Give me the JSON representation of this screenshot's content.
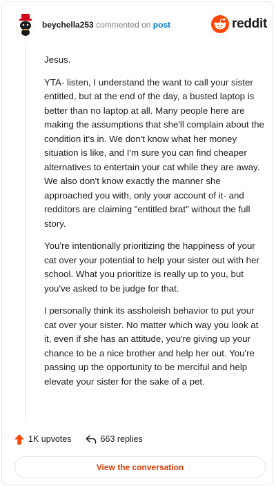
{
  "header": {
    "username": "beychella253",
    "action_text": "commented on",
    "post_link": "post",
    "brand": "reddit"
  },
  "comment": {
    "paragraphs": [
      "Jesus.",
      "YTA- listen, I understand the want to call your sister entitled, but at the end of the day, a busted laptop is better than no laptop at all. Many people here are making the assumptions that she'll complain about the condition it's in. We don't know what her money situation is like, and I'm sure you can find cheaper alternatives to entertain your cat while they are away. We also don't know exactly the manner she approached you with, only your account of it- and redditors are claiming \"entitled brat\" without the full story.",
      "You're intentionally prioritizing the happiness of your cat over your potential to help your sister out with her school. What you prioritize is really up to you, but you've asked to be judge for that.",
      "I personally think its assholeish behavior to put your cat over your sister. No matter which way you look at it, even if she has an attitude, you're giving up your chance to be a nice brother and help her out. You're passing up the opportunity to be merciful and help elevate your sister for the sake of a pet."
    ]
  },
  "actions": {
    "upvotes": "1K upvotes",
    "replies": "663 replies"
  },
  "cta_label": "View the conversation",
  "colors": {
    "accent_orange": "#d93a00",
    "upvote_red": "#ff4500",
    "link_blue": "#0079d3"
  }
}
